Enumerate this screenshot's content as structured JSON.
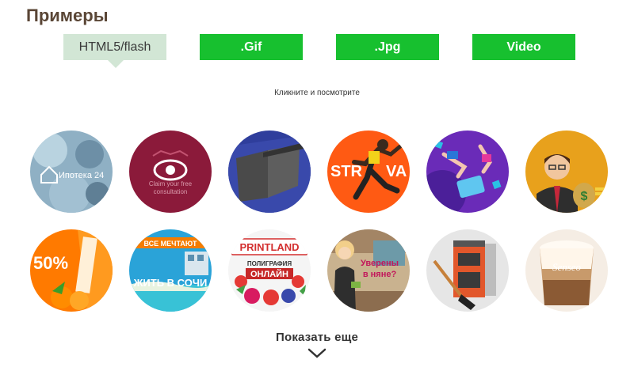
{
  "page": {
    "title": "Примеры"
  },
  "tabs": [
    {
      "label": "HTML5/flash",
      "active": true
    },
    {
      "label": ".Gif",
      "active": false
    },
    {
      "label": ".Jpg",
      "active": false
    },
    {
      "label": "Video",
      "active": false
    }
  ],
  "hint": "Кликните и посмотрите",
  "thumbnails": {
    "row1": [
      {
        "id": "ipoteka",
        "text1": "Ипотека 24"
      },
      {
        "id": "consultation",
        "text1": "Claim your free",
        "text2": "consultation"
      },
      {
        "id": "roof",
        "text1": ""
      },
      {
        "id": "runner",
        "text1": "STR",
        "text2": "VA"
      },
      {
        "id": "games",
        "text1": ""
      },
      {
        "id": "businessman",
        "text1": "$"
      }
    ],
    "row2": [
      {
        "id": "sale",
        "text1": "50%"
      },
      {
        "id": "sochi",
        "text1": "ВСЕ МЕЧТАЮТ",
        "text2": "ЖИТЬ В СОЧИ"
      },
      {
        "id": "printland",
        "text1": "PRINTLAND",
        "text2": "ПОЛИГРАФИЯ",
        "text3": "ОНЛАЙН"
      },
      {
        "id": "nanny",
        "text1": "Уверены",
        "text2": "в няне?"
      },
      {
        "id": "boiler",
        "text1": ""
      },
      {
        "id": "coffee",
        "text1": "Senseo"
      }
    ]
  },
  "show_more": {
    "label": "Показать еще"
  },
  "colors": {
    "accent_green": "#17c02f",
    "active_tab_bg": "#d2e6d5",
    "title_brown": "#5a4636"
  }
}
